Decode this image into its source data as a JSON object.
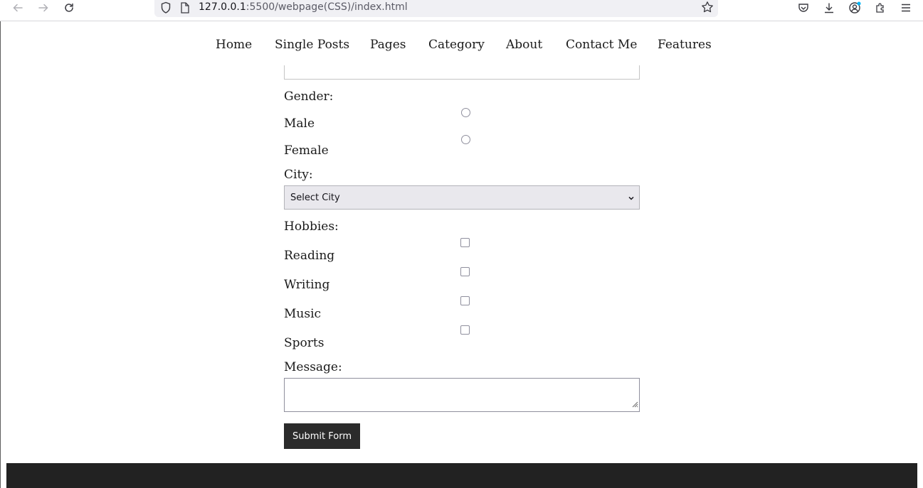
{
  "browser": {
    "url_host": "127.0.0.1",
    "url_rest": ":5500/webpage(CSS)/index.html",
    "icons": [
      "back-arrow-icon",
      "forward-arrow-icon",
      "reload-icon",
      "shield-icon",
      "page-icon",
      "bookmark-star-icon",
      "pocket-icon",
      "download-icon",
      "account-icon",
      "extensions-icon",
      "menu-icon"
    ]
  },
  "nav": {
    "items": [
      "Home",
      "Single Posts",
      "Pages",
      "Category",
      "About",
      "Contact Me",
      "Features"
    ]
  },
  "form": {
    "gender_label": "Gender:",
    "gender_options": [
      "Male",
      "Female"
    ],
    "city_label": "City:",
    "city_selected": "Select City",
    "hobbies_label": "Hobbies:",
    "hobbies_options": [
      "Reading",
      "Writing",
      "Music",
      "Sports"
    ],
    "message_label": "Message:",
    "message_value": "",
    "submit_label": "Submit Form"
  },
  "colors": {
    "footer_bg": "#222222",
    "button_bg": "#2b2b2b",
    "select_bg": "#e9e8ed"
  }
}
